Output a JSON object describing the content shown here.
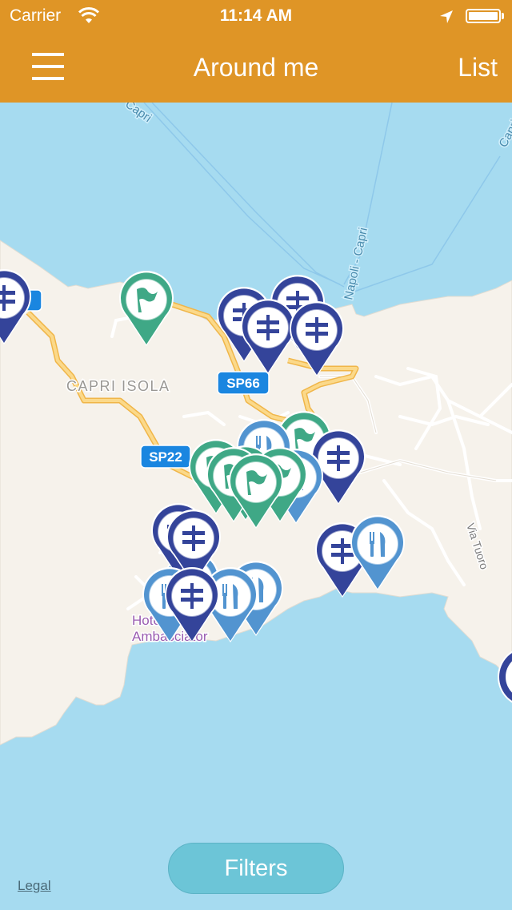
{
  "status_bar": {
    "carrier": "Carrier",
    "time": "11:14 AM",
    "wifi_icon": "wifi-icon",
    "location_icon": "location-arrow-icon",
    "battery_level": 1.0
  },
  "nav_bar": {
    "title": "Around me",
    "menu_icon": "hamburger-menu-icon",
    "right_button": "List"
  },
  "colors": {
    "nav_bar": "#df9526",
    "sea": "#a6dbf0",
    "land": "#f6f2eb",
    "road_major": "#f6c25a",
    "pin_signpost": "#34449a",
    "pin_restaurant": "#5294d0",
    "pin_flag": "#3fa886",
    "road_shield": "#1a86e0",
    "filters_button": "#6cc5d7"
  },
  "map": {
    "labels": [
      {
        "text": "CAPRI ISOLA",
        "type": "town"
      },
      {
        "text": "Capri",
        "type": "ferry-route"
      },
      {
        "text": "Napoli - Capri",
        "type": "ferry-route"
      },
      {
        "text": "Capri",
        "type": "ferry-route"
      },
      {
        "text": "Via Tuoro",
        "type": "street"
      },
      {
        "text": "Hotel Ambasciator",
        "type": "poi"
      }
    ],
    "road_shields": [
      "SP66",
      "SP22",
      "SP"
    ],
    "pin_legend": {
      "signpost": "signpost-icon",
      "restaurant": "fork-knife-icon",
      "flag": "flag-icon"
    },
    "pins": [
      {
        "kind": "signpost"
      },
      {
        "kind": "flag"
      },
      {
        "kind": "signpost"
      },
      {
        "kind": "signpost"
      },
      {
        "kind": "signpost"
      },
      {
        "kind": "signpost"
      },
      {
        "kind": "flag"
      },
      {
        "kind": "restaurant"
      },
      {
        "kind": "flag"
      },
      {
        "kind": "restaurant"
      },
      {
        "kind": "signpost"
      },
      {
        "kind": "flag"
      },
      {
        "kind": "flag"
      },
      {
        "kind": "flag"
      },
      {
        "kind": "restaurant"
      },
      {
        "kind": "flag"
      },
      {
        "kind": "signpost"
      },
      {
        "kind": "signpost"
      },
      {
        "kind": "signpost"
      },
      {
        "kind": "restaurant"
      },
      {
        "kind": "restaurant"
      },
      {
        "kind": "restaurant"
      },
      {
        "kind": "restaurant"
      },
      {
        "kind": "signpost"
      }
    ]
  },
  "footer": {
    "legal_link": "Legal",
    "filters_button": "Filters"
  }
}
